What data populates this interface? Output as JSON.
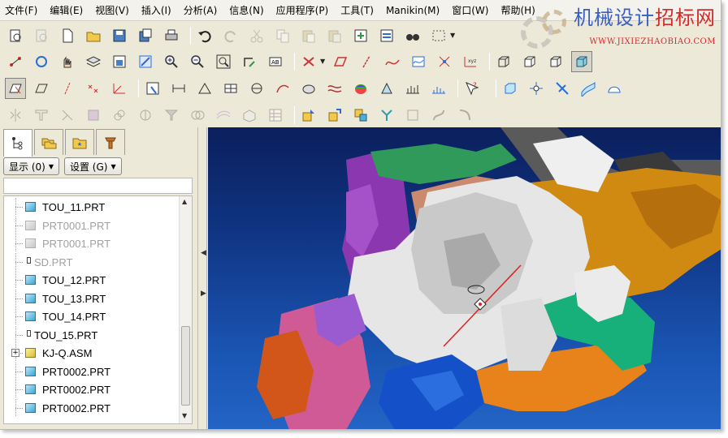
{
  "menubar": {
    "items": [
      "文件(F)",
      "编辑(E)",
      "视图(V)",
      "插入(I)",
      "分析(A)",
      "信息(N)",
      "应用程序(P)",
      "工具(T)",
      "Manikin(M)",
      "窗口(W)",
      "帮助(H)"
    ]
  },
  "watermark": {
    "title_part1": "机械设计",
    "title_part2": "招标网",
    "url": "WWW.JIXIEZHAOBIAO.COM",
    "color_blue": "#3b5fc0",
    "color_red": "#d62a2a"
  },
  "left_panel": {
    "show_button": "显示 (0)",
    "settings_button": "设置 (G)",
    "tree": [
      {
        "label": "TOU_11.PRT",
        "icon": "part-icon",
        "state": "normal"
      },
      {
        "label": "PRT0001.PRT",
        "icon": "part-icon",
        "state": "suppressed"
      },
      {
        "label": "PRT0001.PRT",
        "icon": "part-icon",
        "state": "suppressed"
      },
      {
        "label": "SD.PRT",
        "icon": "small-part-icon",
        "state": "suppressed"
      },
      {
        "label": "TOU_12.PRT",
        "icon": "part-icon",
        "state": "normal"
      },
      {
        "label": "TOU_13.PRT",
        "icon": "part-icon",
        "state": "normal"
      },
      {
        "label": "TOU_14.PRT",
        "icon": "part-icon",
        "state": "normal"
      },
      {
        "label": "TOU_15.PRT",
        "icon": "small-part-icon",
        "state": "normal"
      },
      {
        "label": "KJ-Q.ASM",
        "icon": "assembly-icon",
        "state": "normal",
        "expandable": true
      },
      {
        "label": "PRT0002.PRT",
        "icon": "part-icon",
        "state": "normal"
      },
      {
        "label": "PRT0002.PRT",
        "icon": "part-icon",
        "state": "normal"
      },
      {
        "label": "PRT0002.PRT",
        "icon": "part-icon",
        "state": "normal"
      }
    ]
  },
  "colors": {
    "viewport_top": "#0b1f5c",
    "viewport_bottom": "#2364c4"
  }
}
